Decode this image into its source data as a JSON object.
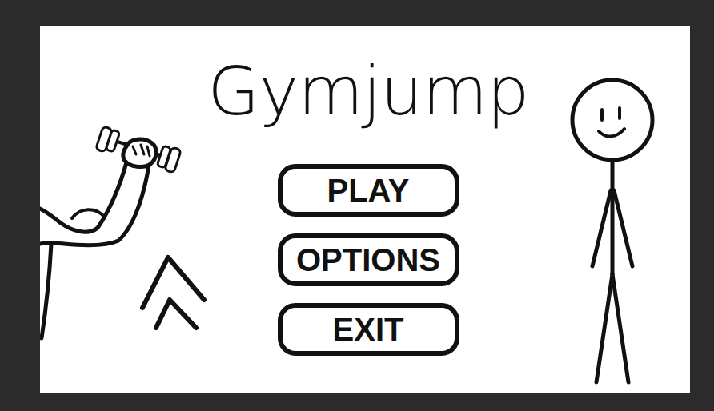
{
  "title": "Gymjump",
  "buttons": [
    {
      "label": "PLAY"
    },
    {
      "label": "OPTIONS"
    },
    {
      "label": "EXIT"
    }
  ]
}
